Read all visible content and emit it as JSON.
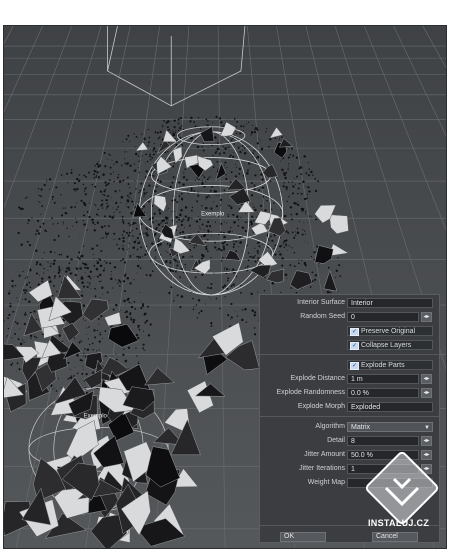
{
  "viewport": {
    "labels": [
      "Exemplo",
      "Exemplo"
    ]
  },
  "dialog": {
    "interior_surface": {
      "label": "Interior Surface",
      "value": "Interior"
    },
    "random_seed": {
      "label": "Random Seed",
      "value": "0"
    },
    "preserve_original": {
      "label": "Preserve Original",
      "checked": true
    },
    "collapse_layers": {
      "label": "Collapse Layers",
      "checked": true
    },
    "explode_parts": {
      "label": "Explode Parts",
      "checked": true
    },
    "explode_distance": {
      "label": "Explode Distance",
      "value": "1 m"
    },
    "explode_randomness": {
      "label": "Explode Randomness",
      "value": "0.0 %"
    },
    "explode_morph": {
      "label": "Explode Morph",
      "value": "Exploded"
    },
    "algorithm": {
      "label": "Algorithm",
      "value": "Matrix"
    },
    "detail": {
      "label": "Detail",
      "value": "8"
    },
    "jitter_amount": {
      "label": "Jitter Amount",
      "value": "50.0 %"
    },
    "jitter_iterations": {
      "label": "Jitter Iterations",
      "value": "1"
    },
    "weight_map": {
      "label": "Weight Map",
      "value": ""
    },
    "ok_label": "OK",
    "cancel_label": "Cancel"
  },
  "watermark": {
    "text": "INSTALUJ.CZ"
  },
  "colors": {
    "background": "#4a4d50",
    "panel": "#3b3d40",
    "accent": "#c9d9ee"
  }
}
